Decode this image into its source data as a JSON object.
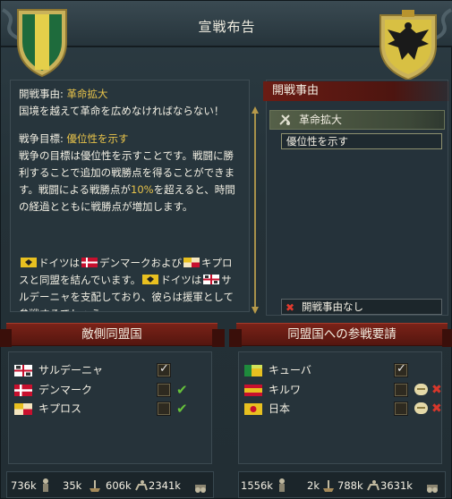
{
  "window": {
    "title": "宣戦布告"
  },
  "description": {
    "cb_label": "開戦事由: ",
    "cb_value": "革命拡大",
    "cb_desc": "国境を越えて革命を広めなければならない！",
    "goal_label": "戦争目標: ",
    "goal_value": "優位性を示す",
    "goal_desc_1": "戦争の目標は優位性を示すことです。戦闘に勝利することで追加の戦勝点を得ることができます。戦闘による戦勝点が",
    "goal_pct": "10%",
    "goal_desc_2": "を超えると、時間の経過とともに戦勝点が増加します。",
    "alliance_a": "ドイツは",
    "alliance_b": "デンマークおよび",
    "alliance_c": "キプロスと同盟を結んでいます。",
    "alliance_d": "ドイツは",
    "alliance_e": "サルデーニャを支配しており、彼らは援軍として参戦するでしょう。"
  },
  "cb_panel": {
    "header": "開戦事由",
    "selected_cb": "革命拡大",
    "goal": "優位性を示す",
    "no_cb": "開戦事由なし"
  },
  "enemy": {
    "title": "敵側同盟国",
    "rows": [
      {
        "name": "サルデーニャ",
        "checked": true
      },
      {
        "name": "デンマーク",
        "checked": false
      },
      {
        "name": "キプロス",
        "checked": false
      }
    ],
    "stats": {
      "army": "736k",
      "navy": "35k",
      "cavalry": "606k",
      "manpower": "2341k"
    }
  },
  "allies": {
    "title": "同盟国への参戦要請",
    "rows": [
      {
        "name": "キューバ",
        "checked": true
      },
      {
        "name": "キルワ",
        "checked": false
      },
      {
        "name": "日本",
        "checked": false
      }
    ],
    "stats": {
      "army": "1556k",
      "navy": "2k",
      "cavalry": "788k",
      "manpower": "3631k"
    }
  },
  "colors": {
    "accent_red": "#7a2218",
    "highlight_gold": "#e9c44a",
    "ok_green": "#66c23a",
    "deny_red": "#d8372b"
  },
  "icons": [
    "shield-icon",
    "eagle-icon",
    "cb-icon",
    "checkmark-icon",
    "cross-icon",
    "chat-icon",
    "soldier-icon",
    "ship-icon",
    "cavalry-icon",
    "cannon-icon"
  ]
}
